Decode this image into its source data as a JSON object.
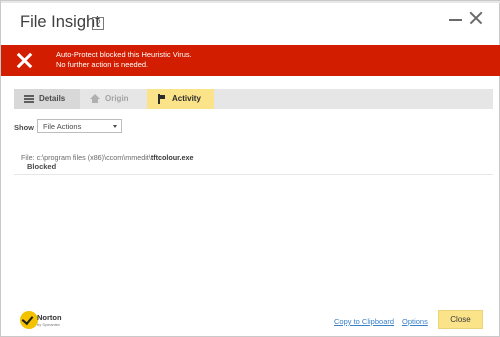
{
  "window": {
    "title": "File Insight",
    "help_glyph": "?"
  },
  "alert": {
    "line1": "Auto-Protect blocked this Heuristic Virus.",
    "line2": "No further action is needed.",
    "color": "#d21d00"
  },
  "tabs": [
    {
      "label": "Details",
      "icon": "details-lines-icon"
    },
    {
      "label": "Origin",
      "icon": "home-icon"
    },
    {
      "label": "Activity",
      "icon": "flag-icon",
      "selected": true
    }
  ],
  "filter": {
    "label": "Show",
    "selected": "File Actions"
  },
  "activity": {
    "file_prefix": "File: c:\\program files (x86)\\ccom\\mmedit\\",
    "file_name": "tftcolour.exe",
    "status": "Blocked"
  },
  "footer": {
    "brand": "Norton",
    "brand_sub": "by Symantec",
    "copy_link": "Copy to Clipboard",
    "options_link": "Options",
    "close_button": "Close",
    "accent_color": "#fbe38a"
  }
}
